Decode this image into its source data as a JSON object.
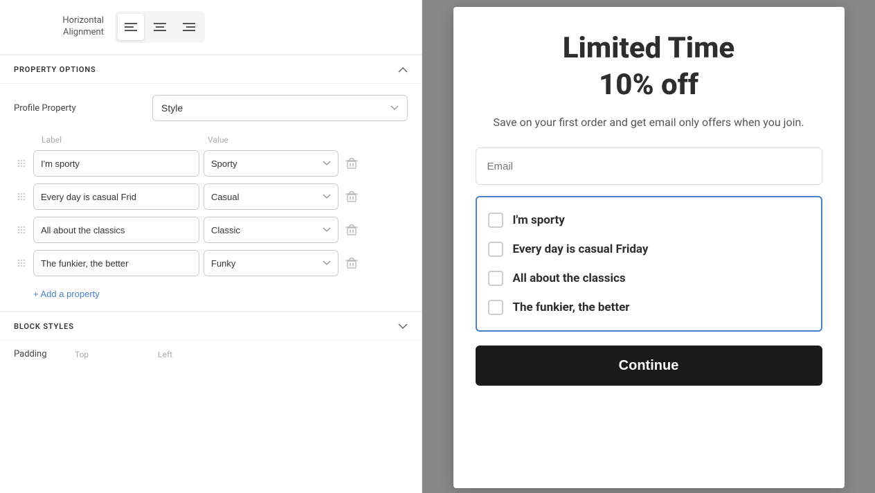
{
  "leftPanel": {
    "alignment": {
      "label": "Horizontal\nAlignment",
      "buttons": [
        "left",
        "center",
        "right"
      ],
      "active": "left"
    },
    "propertyOptions": {
      "sectionTitle": "PROPERTY OPTIONS",
      "profilePropertyLabel": "Profile Property",
      "profilePropertyValue": "Style",
      "labelsHeader": "Label",
      "valuesHeader": "Value",
      "rows": [
        {
          "label": "I'm sporty",
          "value": "Sporty"
        },
        {
          "label": "Every day is casual Frid",
          "value": "Casual"
        },
        {
          "label": "All about the classics",
          "value": "Classic"
        },
        {
          "label": "The funkier, the better",
          "value": "Funky"
        }
      ],
      "addPropertyLabel": "+ Add a property"
    },
    "blockStyles": {
      "sectionTitle": "BLOCK STYLES",
      "paddingLabel": "Padding",
      "paddingTop": "Top",
      "paddingLeft": "Left"
    }
  },
  "rightPanel": {
    "card": {
      "title": "Limited Time",
      "discount": "10% off",
      "subtitle": "Save on your first order and get email only offers when you join.",
      "emailPlaceholder": "Email",
      "checkboxItems": [
        "I'm sporty",
        "Every day is casual Friday",
        "All about the classics",
        "The funkier, the better"
      ],
      "continueLabel": "Continue"
    }
  }
}
